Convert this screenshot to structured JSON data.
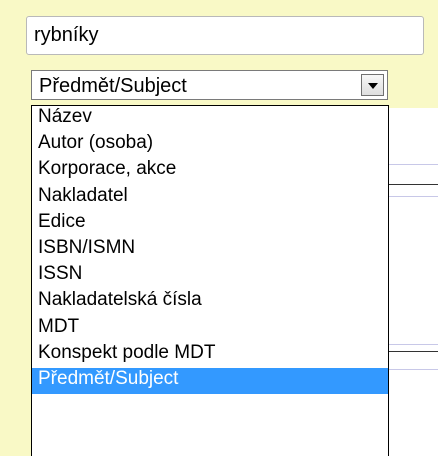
{
  "search": {
    "value": "rybníky"
  },
  "search_field_select": {
    "selected": "Předmět/Subject",
    "options": [
      "Název",
      "Autor (osoba)",
      "Korporace, akce",
      "Nakladatel",
      "Edice",
      "ISBN/ISMN",
      "ISSN",
      "Nakladatelská čísla",
      "MDT",
      "Konspekt podle MDT",
      "Předmět/Subject"
    ],
    "highlighted_index": 10
  },
  "colors": {
    "page_background": "#f9f9c6",
    "highlight": "#3399ff",
    "separator_line_dark": "#333333",
    "separator_line_light": "#c8c8e8"
  }
}
